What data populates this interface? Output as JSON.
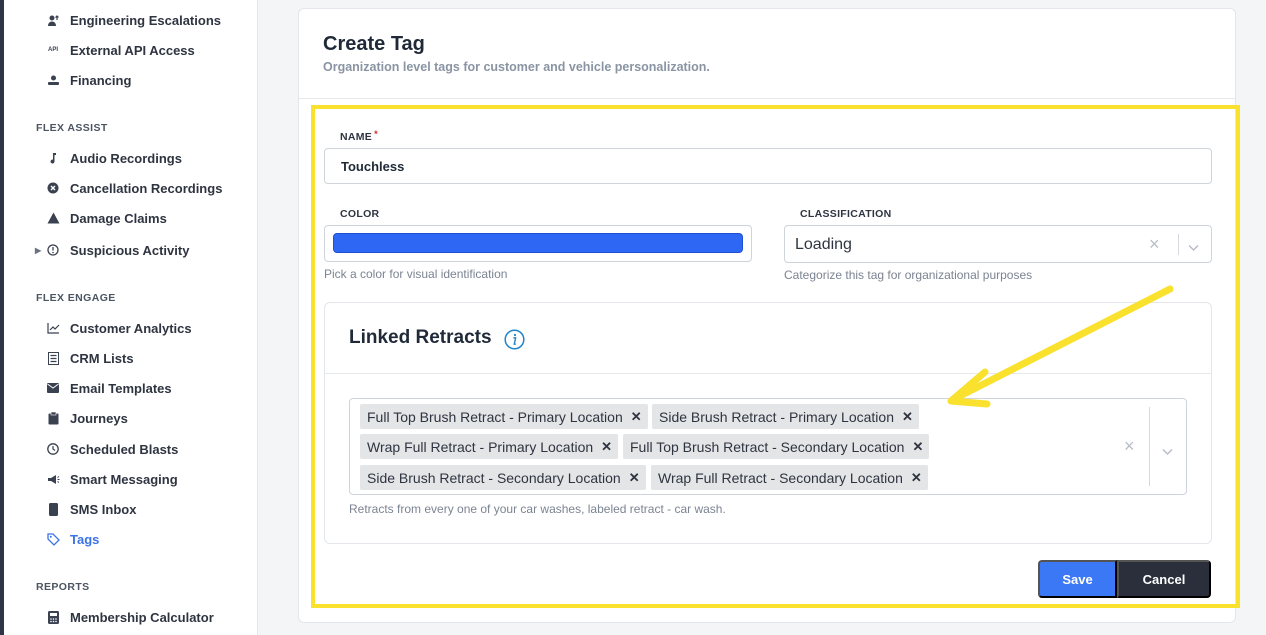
{
  "sidebar": {
    "top_items": [
      {
        "label": "Engineering Escalations",
        "icon": "user-escalation-icon"
      },
      {
        "label": "External API Access",
        "icon": "api-icon"
      },
      {
        "label": "Financing",
        "icon": "financing-icon"
      }
    ],
    "flex_assist": {
      "label": "FLEX ASSIST",
      "items": [
        {
          "label": "Audio Recordings",
          "icon": "music-note-icon"
        },
        {
          "label": "Cancellation Recordings",
          "icon": "cancel-circle-icon"
        },
        {
          "label": "Damage Claims",
          "icon": "warning-triangle-icon"
        },
        {
          "label": "Suspicious Activity",
          "icon": "alert-circle-icon"
        }
      ]
    },
    "flex_engage": {
      "label": "FLEX ENGAGE",
      "items": [
        {
          "label": "Customer Analytics",
          "icon": "line-chart-icon"
        },
        {
          "label": "CRM Lists",
          "icon": "list-icon"
        },
        {
          "label": "Email Templates",
          "icon": "envelope-icon"
        },
        {
          "label": "Journeys",
          "icon": "clipboard-icon"
        },
        {
          "label": "Scheduled Blasts",
          "icon": "clock-icon"
        },
        {
          "label": "Smart Messaging",
          "icon": "megaphone-icon"
        },
        {
          "label": "SMS Inbox",
          "icon": "phone-icon"
        },
        {
          "label": "Tags",
          "icon": "tag-icon"
        }
      ]
    },
    "reports": {
      "label": "REPORTS",
      "items": [
        {
          "label": "Membership Calculator",
          "icon": "calculator-icon"
        }
      ]
    },
    "active_item": "Tags",
    "active_color": "#3b73e6"
  },
  "form": {
    "title": "Create Tag",
    "subtitle": "Organization level tags for customer and vehicle personalization.",
    "name": {
      "label": "NAME",
      "required_mark": "*",
      "value": "Touchless"
    },
    "color": {
      "label": "COLOR",
      "value": "#2f67f5",
      "help": "Pick a color for visual identification"
    },
    "classification": {
      "label": "CLASSIFICATION",
      "value": "Loading",
      "help": "Categorize this tag for organizational purposes"
    },
    "linked_retracts": {
      "title": "Linked Retracts",
      "selected": [
        "Full Top Brush Retract - Primary Location",
        "Side Brush Retract - Primary Location",
        "Wrap Full Retract - Primary Location",
        "Full Top Brush Retract - Secondary Location",
        "Side Brush Retract - Secondary Location",
        "Wrap Full Retract - Secondary Location"
      ],
      "help": "Retracts from every one of your car washes, labeled retract - car wash."
    },
    "save_label": "Save",
    "cancel_label": "Cancel"
  },
  "annotation": {
    "highlight_color": "#f9e12d"
  }
}
